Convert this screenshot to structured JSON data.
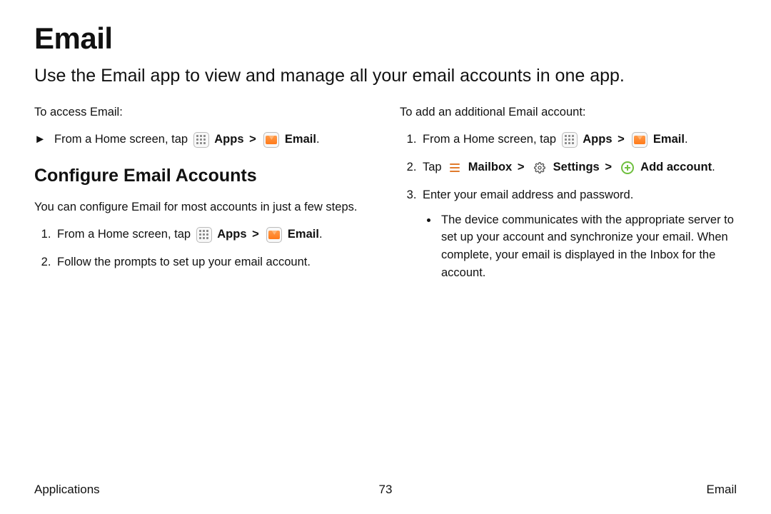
{
  "title": "Email",
  "intro": "Use the Email app to view and manage all your email accounts in one app.",
  "left": {
    "access_label": "To access Email:",
    "arrow_bullet": "►",
    "access_step_prefix": "From a Home screen, tap ",
    "apps_label": "Apps",
    "caret": ">",
    "email_label": "Email",
    "period": ".",
    "configure_heading": "Configure Email Accounts",
    "configure_intro": "You can configure Email for most accounts in just a few steps.",
    "step1_prefix": "From a Home screen, tap ",
    "step2": "Follow the prompts to set up your email account."
  },
  "right": {
    "add_label": "To add an additional Email account:",
    "step1_prefix": "From a Home screen, tap ",
    "apps_label": "Apps",
    "caret": ">",
    "email_label": "Email",
    "period": ".",
    "step2_prefix": "Tap ",
    "mailbox_label": "Mailbox",
    "settings_label": "Settings",
    "add_account_label": "Add account",
    "step3": "Enter your email address and password.",
    "sub_bullet": "The device communicates with the appropriate server to set up your account and synchronize your email. When complete, your email is displayed in the Inbox for the account."
  },
  "footer": {
    "left": "Applications",
    "center": "73",
    "right": "Email"
  }
}
